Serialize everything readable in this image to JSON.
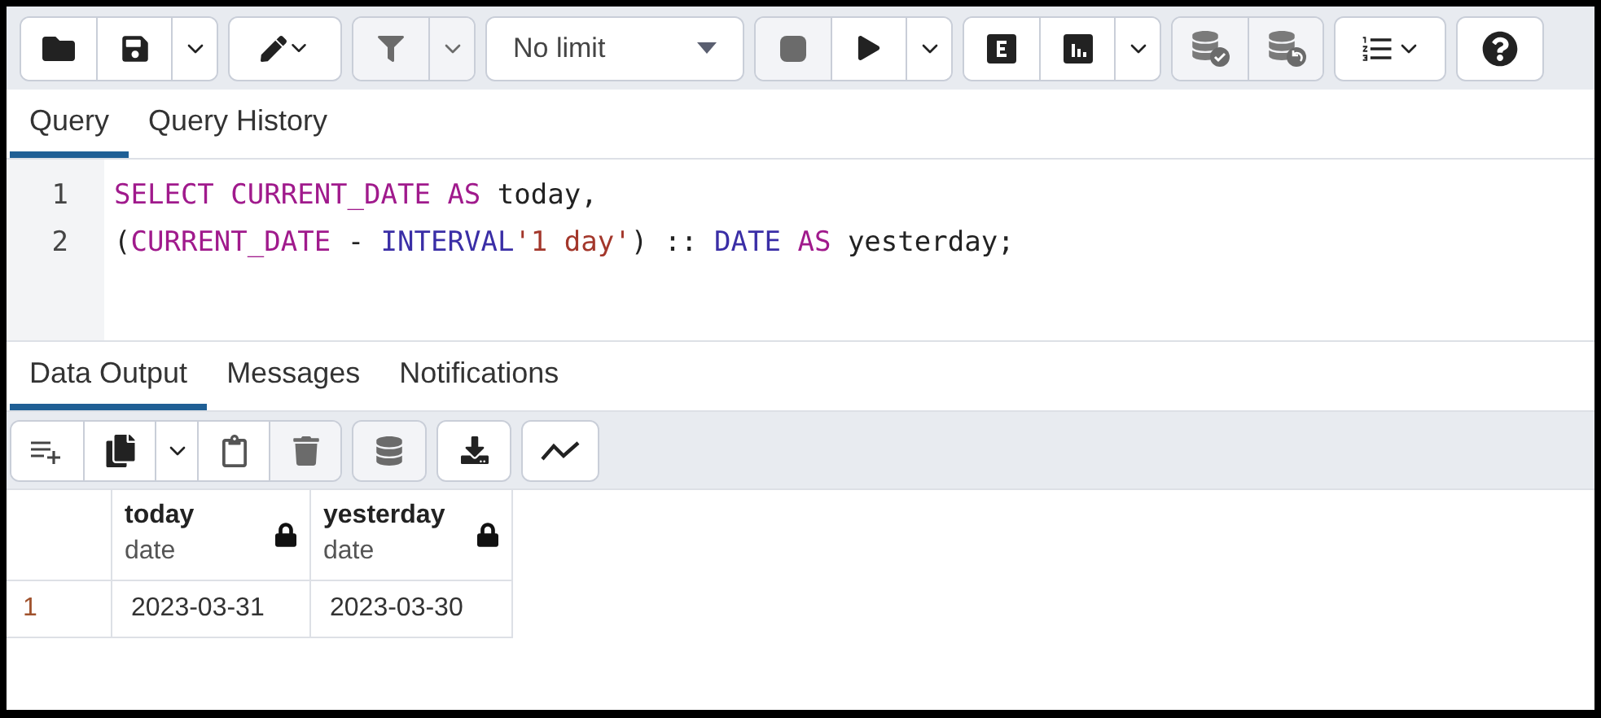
{
  "toolbar": {
    "groups": [
      {
        "buttons": [
          {
            "kind": "open",
            "disabled": false
          },
          {
            "kind": "save",
            "disabled": false
          },
          {
            "kind": "caret",
            "disabled": false
          }
        ]
      },
      {
        "buttons": [
          {
            "kind": "edit",
            "disabled": false
          }
        ]
      },
      {
        "buttons": [
          {
            "kind": "filter",
            "disabled": true
          },
          {
            "kind": "caret",
            "disabled": true
          }
        ]
      },
      {
        "buttons": [
          {
            "kind": "limit",
            "label": "No limit",
            "disabled": false
          }
        ]
      },
      {
        "buttons": [
          {
            "kind": "stop",
            "disabled": true
          },
          {
            "kind": "run",
            "disabled": false
          },
          {
            "kind": "caret",
            "disabled": false
          }
        ]
      },
      {
        "buttons": [
          {
            "kind": "explain",
            "disabled": false
          },
          {
            "kind": "analyze",
            "disabled": false
          },
          {
            "kind": "caret",
            "disabled": false
          }
        ]
      },
      {
        "buttons": [
          {
            "kind": "commit",
            "disabled": true
          },
          {
            "kind": "rollback",
            "disabled": true
          }
        ]
      },
      {
        "buttons": [
          {
            "kind": "macros",
            "disabled": false
          }
        ]
      },
      {
        "buttons": [
          {
            "kind": "help",
            "disabled": false
          }
        ]
      }
    ]
  },
  "editor_tabs": [
    {
      "label": "Query",
      "selected": true
    },
    {
      "label": "Query History",
      "selected": false
    }
  ],
  "editor": {
    "lines": [
      {
        "number": "1",
        "tokens": [
          {
            "kind": "keyword",
            "text": "SELECT CURRENT_DATE AS"
          },
          {
            "kind": "plain",
            "text": " today,"
          }
        ]
      },
      {
        "number": "2",
        "tokens": [
          {
            "kind": "plain",
            "text": "("
          },
          {
            "kind": "keyword",
            "text": "CURRENT_DATE"
          },
          {
            "kind": "plain",
            "text": " - "
          },
          {
            "kind": "type",
            "text": "INTERVAL"
          },
          {
            "kind": "string",
            "text": "'1 day'"
          },
          {
            "kind": "plain",
            "text": ") :: "
          },
          {
            "kind": "type",
            "text": "DATE"
          },
          {
            "kind": "keyword",
            "text": " AS"
          },
          {
            "kind": "plain",
            "text": " yesterday;"
          }
        ]
      }
    ]
  },
  "output_tabs": [
    {
      "label": "Data Output",
      "selected": true
    },
    {
      "label": "Messages",
      "selected": false
    },
    {
      "label": "Notifications",
      "selected": false
    }
  ],
  "output_toolbar": {
    "groups": [
      {
        "buttons": [
          {
            "kind": "add-row",
            "disabled": false
          },
          {
            "kind": "copy",
            "disabled": false
          },
          {
            "kind": "caret",
            "disabled": false
          },
          {
            "kind": "paste",
            "disabled": false
          },
          {
            "kind": "delete",
            "disabled": true
          }
        ]
      },
      {
        "buttons": [
          {
            "kind": "save-data",
            "disabled": true
          }
        ]
      },
      {
        "buttons": [
          {
            "kind": "download",
            "disabled": false
          }
        ]
      },
      {
        "buttons": [
          {
            "kind": "graph",
            "disabled": false
          }
        ]
      }
    ]
  },
  "table": {
    "columns": [
      {
        "name": "today",
        "type": "date",
        "locked": true
      },
      {
        "name": "yesterday",
        "type": "date",
        "locked": true
      }
    ],
    "rows": [
      {
        "number": "1",
        "cells": [
          "2023-03-31",
          "2023-03-30"
        ]
      }
    ]
  }
}
